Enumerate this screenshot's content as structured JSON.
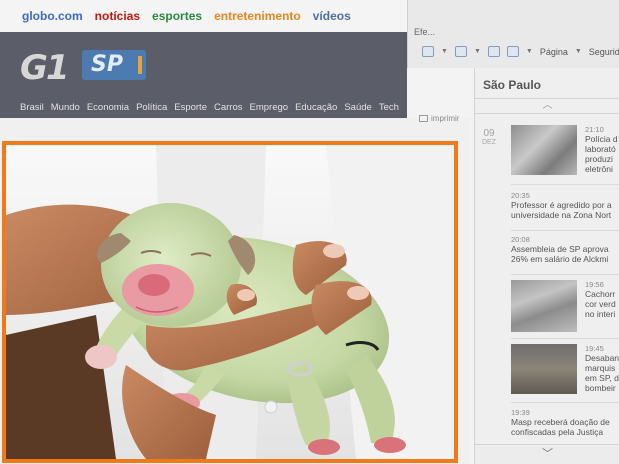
{
  "globo_bar": {
    "logo": "globo.com",
    "links": [
      {
        "label": "notícias",
        "color": "#c4170c"
      },
      {
        "label": "esportes",
        "color": "#2b8a3e"
      },
      {
        "label": "entretenimento",
        "color": "#e5861f"
      },
      {
        "label": "vídeos",
        "color": "#4d6fa6"
      }
    ],
    "logo_color": "#3b6cc2"
  },
  "g1_header": {
    "logo": "G1",
    "region": "SP",
    "nav": [
      "Brasil",
      "Mundo",
      "Economia",
      "Política",
      "Esporte",
      "Carros",
      "Emprego",
      "Educação",
      "Saúde",
      "Tech"
    ]
  },
  "browser": {
    "tab_label": "Efe...",
    "page_menu": "Página",
    "security_menu": "Segurid"
  },
  "print_label": "imprimir",
  "news": {
    "title": "São Paulo",
    "date_day": "09",
    "date_month": "DEZ",
    "items": [
      {
        "time": "21:10",
        "lines": [
          "Polícia d",
          "laborató",
          "produzi",
          "eletrôni"
        ]
      },
      {
        "time": "20:35",
        "lines": [
          "Professor é agredido por a",
          "universidade na Zona Nort"
        ]
      },
      {
        "time": "20:08",
        "lines": [
          "Assembleia de SP aprova",
          "26% em salário de Alckmi"
        ]
      },
      {
        "time": "19:56",
        "lines": [
          "Cachorr",
          "cor verd",
          "no interi"
        ]
      },
      {
        "time": "19:45",
        "lines": [
          "Desaban",
          "marquis",
          "em SP, d",
          "bombeir"
        ]
      },
      {
        "time": "19:39",
        "lines": [
          "Masp receberá doação de",
          "confiscadas pela Justiça"
        ]
      }
    ]
  },
  "colors": {
    "accent_frame": "#f07a1a",
    "header_bg": "#5b5d68"
  }
}
